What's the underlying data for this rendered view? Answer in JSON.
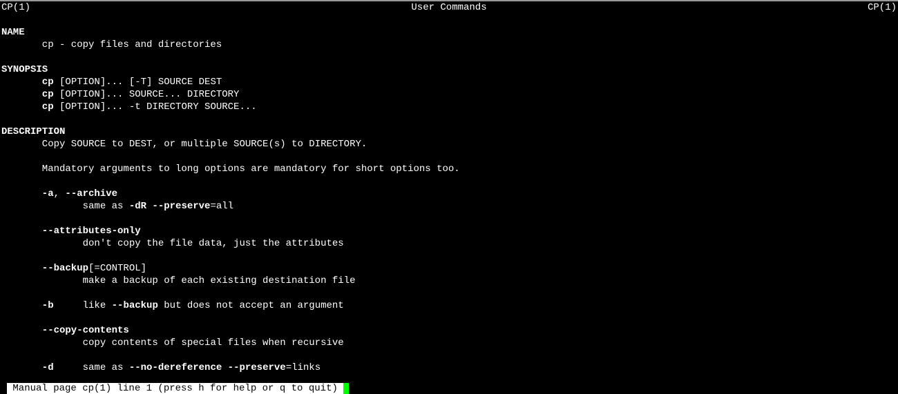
{
  "header": {
    "left": "CP(1)",
    "center": "User Commands",
    "right": "CP(1)"
  },
  "sections": {
    "name": {
      "head": "NAME",
      "line": "cp - copy files and directories"
    },
    "synopsis": {
      "head": "SYNOPSIS",
      "cp": "cp",
      "l1_rest": " [OPTION]... [-T] SOURCE DEST",
      "l2_rest": " [OPTION]... SOURCE... DIRECTORY",
      "l3_rest": " [OPTION]... -t DIRECTORY SOURCE..."
    },
    "description": {
      "head": "DESCRIPTION",
      "p1": "Copy SOURCE to DEST, or multiple SOURCE(s) to DIRECTORY.",
      "p2": "Mandatory arguments to long options are mandatory for short options too.",
      "opt_a": {
        "flag1": "-a",
        "comma": ", ",
        "flag2": "--archive",
        "pre": "same as ",
        "b1": "-dR --preserve",
        "post": "=all"
      },
      "opt_attr": {
        "flag": "--attributes-only",
        "desc": "don't copy the file data, just the attributes"
      },
      "opt_backup": {
        "flag": "--backup",
        "suffix": "[=CONTROL]",
        "desc": "make a backup of each existing destination file"
      },
      "opt_b": {
        "flag": "-b",
        "pad": "     ",
        "pre": "like ",
        "b1": "--backup",
        "post": " but does not accept an argument"
      },
      "opt_copy": {
        "flag": "--copy-contents",
        "desc": "copy contents of special files when recursive"
      },
      "opt_d": {
        "flag": "-d",
        "pad": "     ",
        "pre": "same as ",
        "b1": "--no-dereference --preserve",
        "post": "=links"
      }
    }
  },
  "status": "Manual page cp(1) line 1 (press h for help or q to quit)"
}
